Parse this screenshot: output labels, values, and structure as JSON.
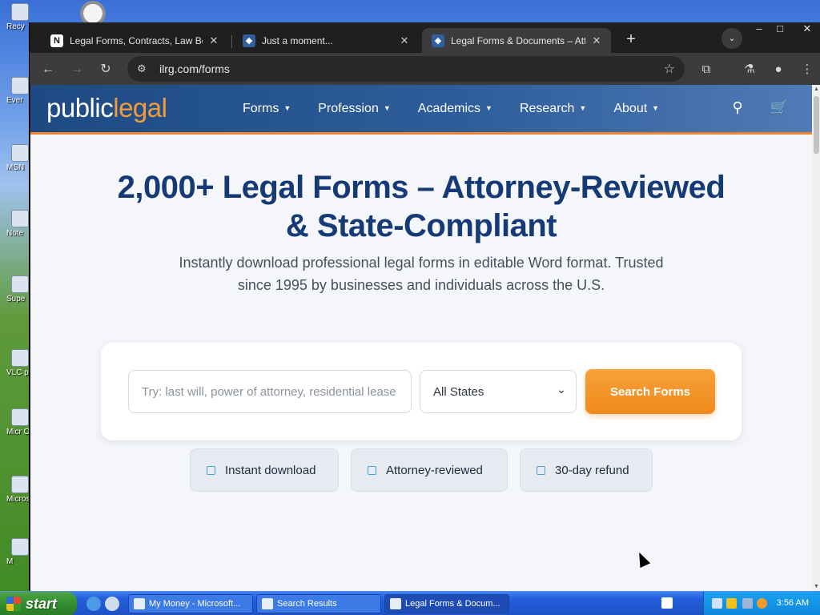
{
  "desktop": {
    "icons": [
      "Recy",
      "Ever",
      "MSN",
      "Note",
      "Supe",
      "VLC pl",
      "Micr Offi",
      "Microsc Studi",
      "M"
    ]
  },
  "browser": {
    "tabs": [
      {
        "title": "Legal Forms, Contracts, Law Books",
        "favicon": "N",
        "active": false
      },
      {
        "title": "Just a moment...",
        "favicon": "shield-logo",
        "active": false
      },
      {
        "title": "Legal Forms & Documents – Attorn",
        "favicon": "shield-logo",
        "active": true
      }
    ],
    "address": "ilrg.com/forms"
  },
  "site": {
    "logo": {
      "part1": "public",
      "part2": "legal"
    },
    "menu": [
      {
        "label": "Forms"
      },
      {
        "label": "Profession"
      },
      {
        "label": "Academics"
      },
      {
        "label": "Research"
      },
      {
        "label": "About"
      }
    ],
    "hero": {
      "title_line1": "2,000+ Legal Forms – Attorney-Reviewed",
      "title_line2": "& State-Compliant",
      "subtitle_line1": "Instantly download professional legal forms in editable Word format. Trusted",
      "subtitle_line2": "since 1995 by businesses and individuals across the U.S."
    },
    "search": {
      "placeholder": "Try: last will, power of attorney, residential lease",
      "state_value": "All States",
      "button": "Search Forms"
    },
    "badges": [
      "Instant download",
      "Attorney-reviewed",
      "30-day refund"
    ]
  },
  "taskbar": {
    "start": "start",
    "tasks": [
      {
        "label": "My Money - Microsoft...",
        "active": false
      },
      {
        "label": "Search Results",
        "active": false
      },
      {
        "label": "Legal Forms & Docum...",
        "active": true
      }
    ],
    "clock": "3:56 AM"
  },
  "colors": {
    "brand_blue": "#163a75",
    "nav_blue": "#1d4a82",
    "accent_orange": "#f0891b",
    "taskbar_blue": "#245edb"
  }
}
